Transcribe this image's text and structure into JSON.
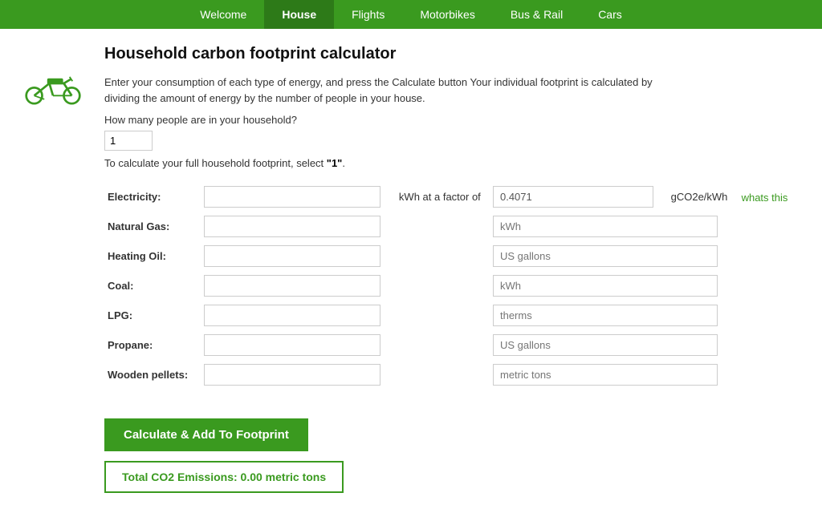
{
  "nav": {
    "items": [
      {
        "label": "Welcome",
        "active": false
      },
      {
        "label": "House",
        "active": true
      },
      {
        "label": "Flights",
        "active": false
      },
      {
        "label": "Motorbikes",
        "active": false
      },
      {
        "label": "Bus & Rail",
        "active": false
      },
      {
        "label": "Cars",
        "active": false
      }
    ]
  },
  "page": {
    "title": "Household carbon footprint calculator",
    "description": "Enter your consumption of each type of energy, and press the Calculate button Your individual footprint is calculated by dividing the amount of energy by the number of people in your house.",
    "household_question": "How many people are in your household?",
    "household_value": "1",
    "select_hint": "To calculate your full household footprint, select \"1\"."
  },
  "electricity": {
    "label": "Electricity:",
    "value": "",
    "factor_label": "kWh at a factor of",
    "factor_value": "0.4071",
    "unit_label": "gCO2e/kWh",
    "whats_this": "whats this"
  },
  "energy_rows": [
    {
      "label": "Natural Gas:",
      "value": "",
      "unit": "kWh"
    },
    {
      "label": "Heating Oil:",
      "value": "",
      "unit": "US gallons"
    },
    {
      "label": "Coal:",
      "value": "",
      "unit": "kWh"
    },
    {
      "label": "LPG:",
      "value": "",
      "unit": "therms"
    },
    {
      "label": "Propane:",
      "value": "",
      "unit": "US gallons"
    },
    {
      "label": "Wooden pellets:",
      "value": "",
      "unit": "metric tons"
    }
  ],
  "buttons": {
    "calculate": "Calculate & Add To Footprint"
  },
  "total": {
    "label": "Total CO2 Emissions: 0.00 metric tons"
  }
}
